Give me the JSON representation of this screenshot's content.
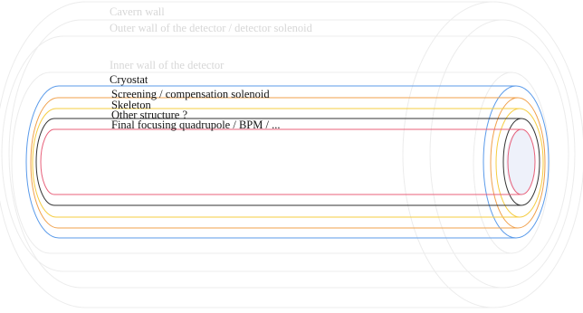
{
  "labels": {
    "cavern_wall": "Cavern wall",
    "outer_wall": "Outer wall of the detector / detector solenoid",
    "inner_wall": "Inner wall of the detector",
    "cryostat": "Cryostat",
    "screening": "Screening / compensation solenoid",
    "skeleton": "Skeleton",
    "other_structure": "Other structure ?",
    "final_focusing": "Final focusing quadrupole / BPM / ..."
  },
  "colors": {
    "cavern_wall": "#ececec",
    "outer_wall": "#ececec",
    "inner_wall": "#ececec",
    "cryostat": "#5b9bea",
    "screening": "#f0a04b",
    "skeleton": "#f5cc40",
    "other_structure": "#333333",
    "final_focusing": "#e8607a",
    "bore_fill": "#eef1fa"
  }
}
